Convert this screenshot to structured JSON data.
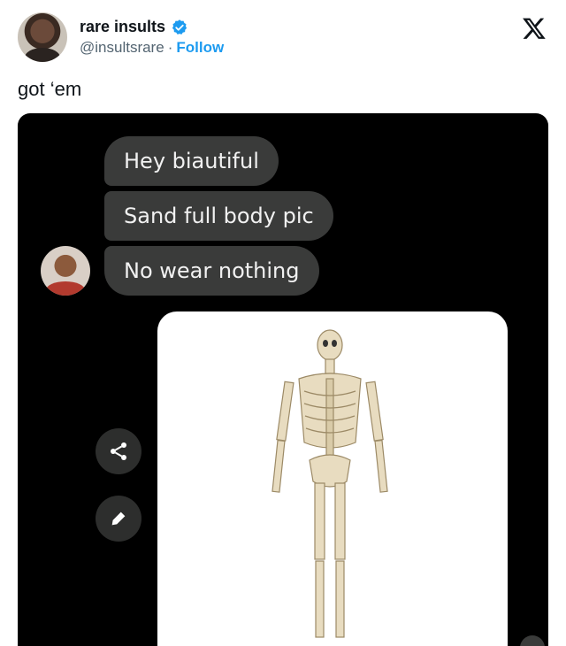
{
  "tweet": {
    "display_name": "rare insults",
    "handle": "@insultsrare",
    "separator": "·",
    "follow_label": "Follow",
    "text": "got ‘em"
  },
  "chat": {
    "messages": [
      "Hey biautiful",
      "Sand full body pic",
      "No wear nothing"
    ]
  },
  "icons": {
    "verified": "verified-badge-icon",
    "platform": "x-logo-icon",
    "share": "share-icon",
    "edit": "pencil-icon"
  },
  "colors": {
    "accent": "#1d9bf0",
    "bubble": "#3a3b3a",
    "media_bg": "#000000"
  }
}
